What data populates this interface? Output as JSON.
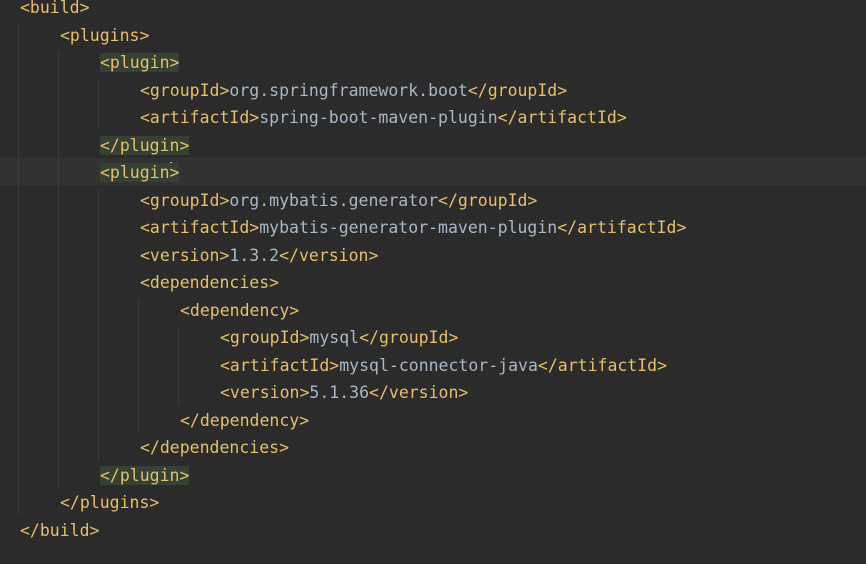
{
  "editor": {
    "language": "xml",
    "lines": [
      {
        "indent": 0,
        "parts": [
          {
            "t": "<build>",
            "k": "tag"
          }
        ]
      },
      {
        "indent": 1,
        "parts": [
          {
            "t": "<plugins>",
            "k": "tag"
          }
        ]
      },
      {
        "indent": 2,
        "parts": [
          {
            "t": "<plugin>",
            "k": "tag",
            "hl": true
          }
        ]
      },
      {
        "indent": 3,
        "parts": [
          {
            "t": "<groupId>",
            "k": "tag"
          },
          {
            "t": "org.springframework.boot",
            "k": "txt"
          },
          {
            "t": "</groupId>",
            "k": "tag"
          }
        ]
      },
      {
        "indent": 3,
        "parts": [
          {
            "t": "<artifactId>",
            "k": "tag"
          },
          {
            "t": "spring-boot-maven-plugin",
            "k": "txt"
          },
          {
            "t": "</artifactId>",
            "k": "tag"
          }
        ]
      },
      {
        "indent": 2,
        "parts": [
          {
            "t": "</plugin>",
            "k": "tag",
            "hl": true
          }
        ]
      },
      {
        "indent": 2,
        "current": true,
        "parts": [
          {
            "t": "<plugin",
            "k": "tag",
            "hl": true,
            "caret": true
          },
          {
            "t": ">",
            "k": "tag",
            "hl": true
          }
        ]
      },
      {
        "indent": 3,
        "parts": [
          {
            "t": "<groupId>",
            "k": "tag"
          },
          {
            "t": "org.mybatis.generator",
            "k": "txt"
          },
          {
            "t": "</groupId>",
            "k": "tag"
          }
        ]
      },
      {
        "indent": 3,
        "parts": [
          {
            "t": "<artifactId>",
            "k": "tag"
          },
          {
            "t": "mybatis-generator-maven-plugin",
            "k": "txt"
          },
          {
            "t": "</artifactId>",
            "k": "tag"
          }
        ]
      },
      {
        "indent": 3,
        "parts": [
          {
            "t": "<version>",
            "k": "tag"
          },
          {
            "t": "1.3.2",
            "k": "txt"
          },
          {
            "t": "</version>",
            "k": "tag"
          }
        ]
      },
      {
        "indent": 3,
        "parts": [
          {
            "t": "<dependencies>",
            "k": "tag"
          }
        ]
      },
      {
        "indent": 4,
        "parts": [
          {
            "t": "<dependency>",
            "k": "tag"
          }
        ]
      },
      {
        "indent": 5,
        "parts": [
          {
            "t": "<groupId>",
            "k": "tag"
          },
          {
            "t": "mysql",
            "k": "txt"
          },
          {
            "t": "</groupId>",
            "k": "tag"
          }
        ]
      },
      {
        "indent": 5,
        "parts": [
          {
            "t": "<artifactId>",
            "k": "tag"
          },
          {
            "t": "mysql-connector-java",
            "k": "txt"
          },
          {
            "t": "</artifactId>",
            "k": "tag"
          }
        ]
      },
      {
        "indent": 5,
        "parts": [
          {
            "t": "<version>",
            "k": "tag"
          },
          {
            "t": "5.1.36",
            "k": "txt"
          },
          {
            "t": "</version>",
            "k": "tag"
          }
        ]
      },
      {
        "indent": 4,
        "parts": [
          {
            "t": "</dependency>",
            "k": "tag"
          }
        ]
      },
      {
        "indent": 3,
        "parts": [
          {
            "t": "</dependencies>",
            "k": "tag"
          }
        ]
      },
      {
        "indent": 2,
        "parts": [
          {
            "t": "</plugin>",
            "k": "tag",
            "hl": true
          }
        ]
      },
      {
        "indent": 1,
        "parts": [
          {
            "t": "</plugins>",
            "k": "tag"
          }
        ]
      },
      {
        "indent": 0,
        "parts": [
          {
            "t": "</build>",
            "k": "tag"
          }
        ]
      }
    ]
  }
}
